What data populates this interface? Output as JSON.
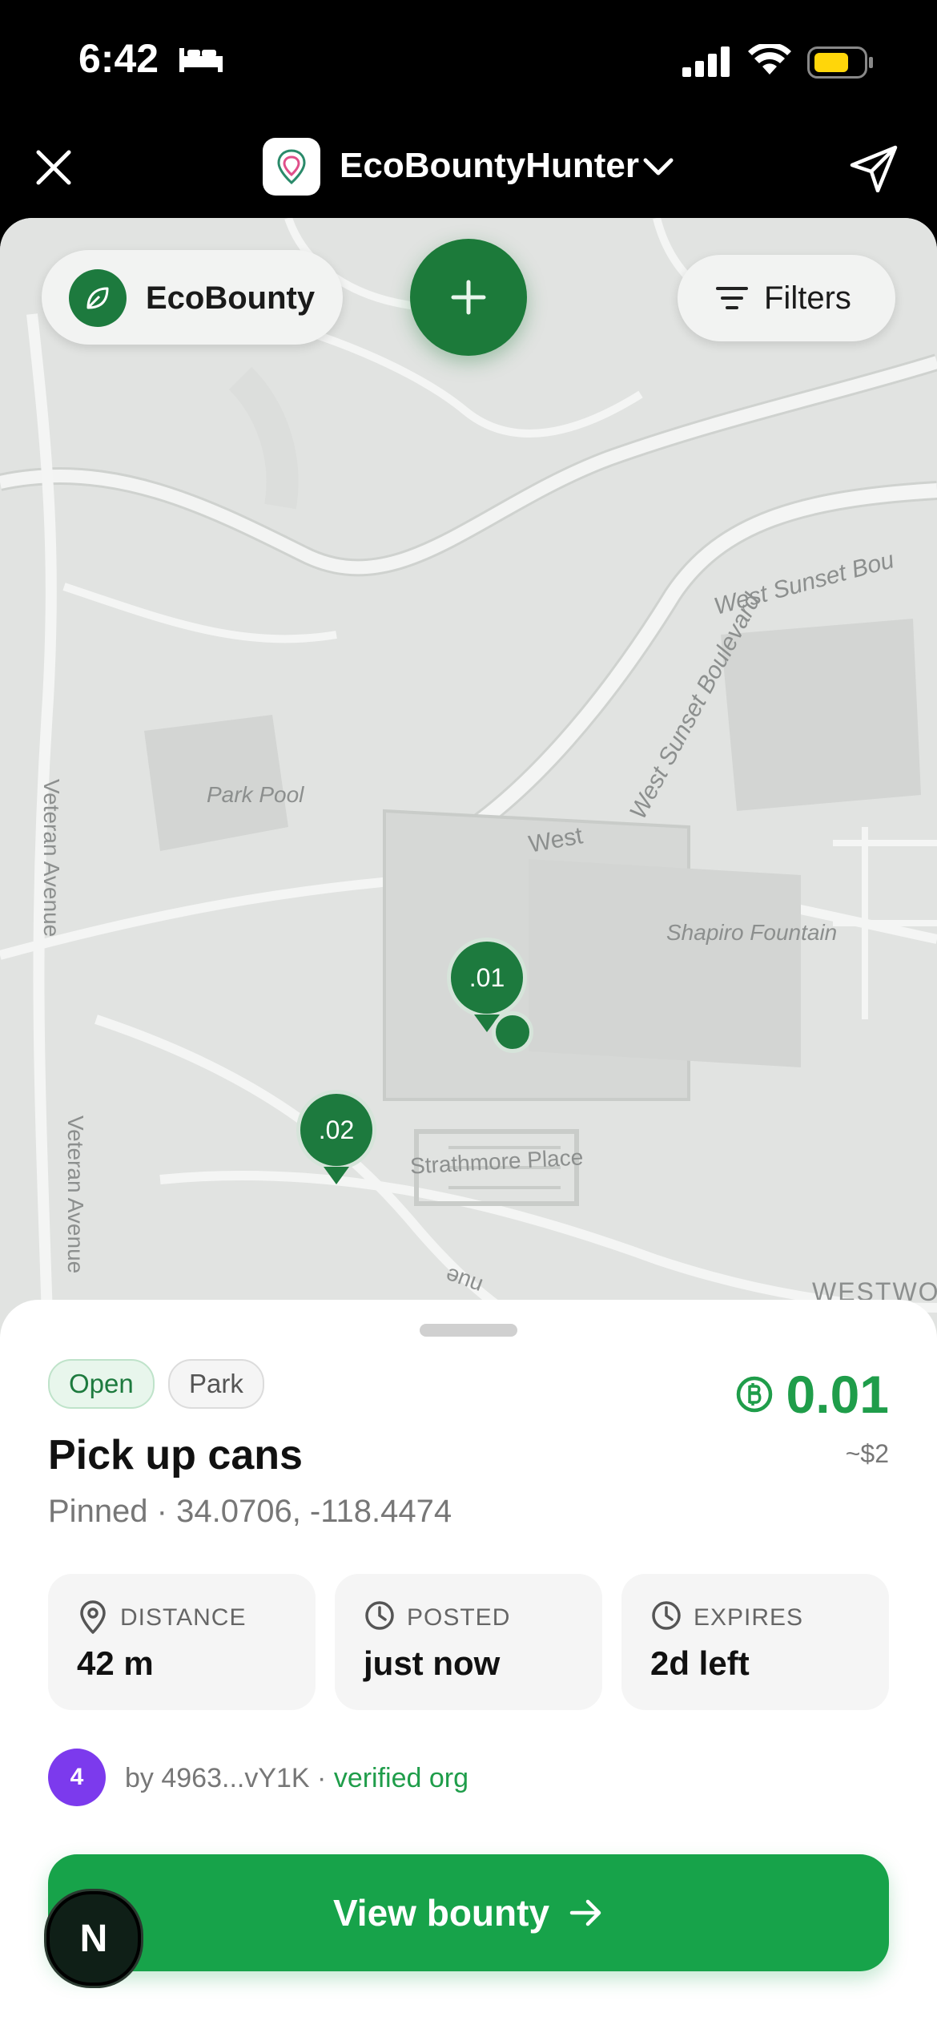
{
  "status_bar": {
    "time": "6:42",
    "bed_icon": "bed-icon",
    "signal_icon": "cellular-signal-icon",
    "wifi_icon": "wifi-icon",
    "battery_icon": "battery-icon"
  },
  "app_bar": {
    "title": "EcoBountyHunter",
    "close_icon": "close-icon",
    "chevron_icon": "chevron-down-icon",
    "share_icon": "send-icon"
  },
  "map": {
    "brand_label": "EcoBounty",
    "filters_label": "Filters",
    "labels": {
      "park_pool": "Park Pool",
      "west_sunset": "West Sunset Boulevard",
      "west_sunset_top": "West Sunset Bou",
      "west": "West",
      "veteran_avenue_top": "Veteran Avenue",
      "veteran_avenue_bottom": "Veteran Avenue",
      "shapiro": "Shapiro Fountain",
      "strathmore": "Strathmore Place",
      "westwood": "WESTWO",
      "nue": "nue"
    },
    "pins": [
      {
        "label": ".01"
      },
      {
        "label": ".02"
      }
    ]
  },
  "sheet": {
    "status_tag": "Open",
    "category_tag": "Park",
    "reward": "0.01",
    "reward_usd": "~$2",
    "title": "Pick up cans",
    "subtitle": "Pinned · 34.0706, -118.4474",
    "stats": [
      {
        "label": "DISTANCE",
        "value": "42 m",
        "icon": "location-pin-icon"
      },
      {
        "label": "POSTED",
        "value": "just now",
        "icon": "clock-icon"
      },
      {
        "label": "EXPIRES",
        "value": "2d left",
        "icon": "clock-icon"
      }
    ],
    "avatar_text": "4",
    "by_text": "by 4963...vY1K · ",
    "verified_text": "verified org",
    "cta_label": "View bounty"
  },
  "floating_badge": "N",
  "colors": {
    "brand_green": "#1d7a3e",
    "cta_green": "#17a34a",
    "reward_green": "#1f9d4a",
    "avatar_purple": "#7c3aed"
  }
}
